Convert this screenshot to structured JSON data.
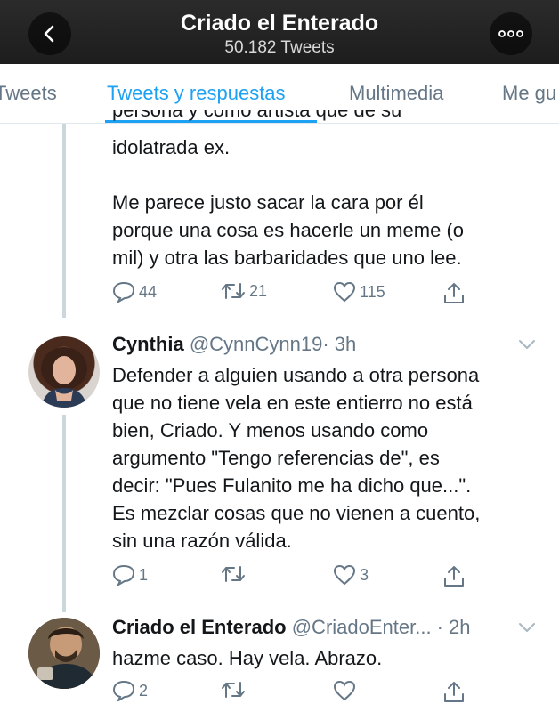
{
  "header": {
    "title": "Criado el Enterado",
    "subtitle": "50.182 Tweets"
  },
  "tabs": [
    {
      "label": "Tweets",
      "active": false
    },
    {
      "label": "Tweets y respuestas",
      "active": true
    },
    {
      "label": "Multimedia",
      "active": false
    },
    {
      "label": "Me gu",
      "active": false
    }
  ],
  "tweets": [
    {
      "partial_top_line": "persona y como artista que de su",
      "text": "idolatrada ex.\n\nMe parece justo sacar la cara por él\nporque una cosa es hacerle un meme (o\nmil) y otra las barbaridades que uno lee.",
      "replies": "44",
      "retweets": "21",
      "likes": "115"
    },
    {
      "name": "Cynthia",
      "handle": "@CynnCynn19",
      "time": "· 3h",
      "text": "Defender a alguien usando a otra persona\nque no tiene vela en este entierro no está\nbien, Criado. Y menos usando como\nargumento \"Tengo referencias de\", es\ndecir: \"Pues Fulanito me ha dicho que...\".\nEs mezclar cosas que no vienen a cuento,\nsin una razón válida.",
      "replies": "1",
      "retweets": "",
      "likes": "3"
    },
    {
      "name": "Criado el Enterado",
      "handle": "@CriadoEnter...",
      "time": "· 2h",
      "text": "hazme caso. Hay vela. Abrazo.",
      "replies": "2",
      "retweets": "",
      "likes": ""
    }
  ],
  "icons": {
    "back": "chevron-left-icon",
    "more": "more-dots-icon",
    "reply": "reply-icon",
    "retweet": "retweet-icon",
    "like": "heart-icon",
    "share": "share-icon",
    "caret": "chevron-down-icon"
  },
  "colors": {
    "accent": "#1da1f2",
    "secondary_text": "#657786",
    "header_bg": "#1d1d1d",
    "thread_line": "#ccd6dd"
  }
}
